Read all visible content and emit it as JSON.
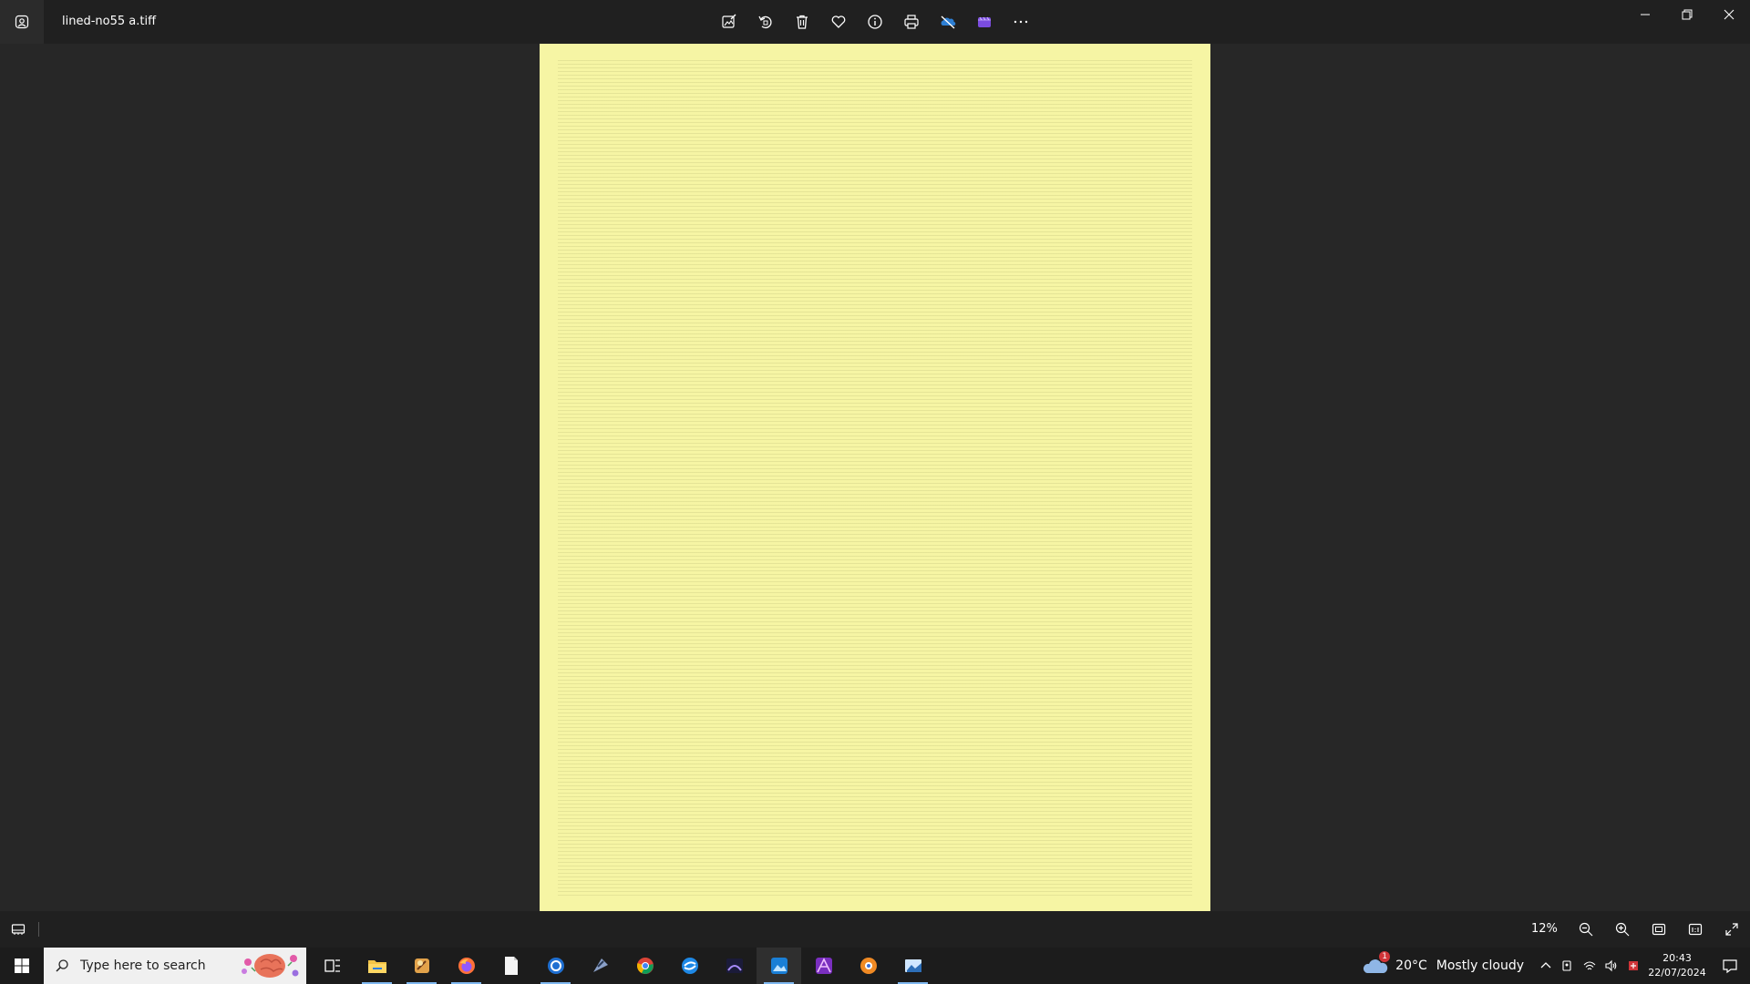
{
  "window": {
    "filename": "lined-no55 a.tiff"
  },
  "toolbar": {
    "icons": [
      "edit-image-icon",
      "rotate-icon",
      "delete-icon",
      "favorite-icon",
      "info-icon",
      "print-icon",
      "onedrive-icon",
      "clipchamp-icon",
      "more-icon"
    ]
  },
  "image": {
    "paper_color": "#f6f5a4"
  },
  "statusbar": {
    "zoom": "12%"
  },
  "taskbar": {
    "search_placeholder": "Type here to search",
    "weather": {
      "badge": "1",
      "temperature": "20°C",
      "condition": "Mostly cloudy"
    },
    "clock": {
      "time": "20:43",
      "date": "22/07/2024"
    }
  }
}
